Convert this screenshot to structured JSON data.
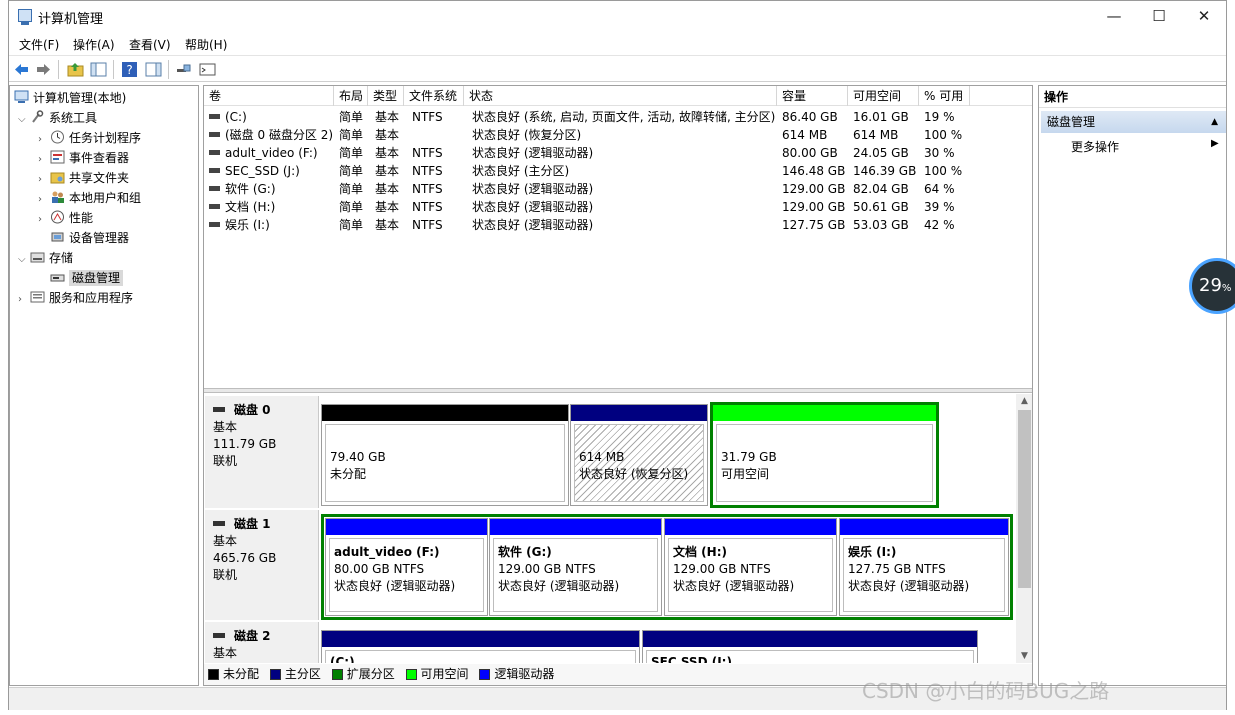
{
  "window": {
    "title": "计算机管理",
    "minimize": "—",
    "maximize": "☐",
    "close": "✕"
  },
  "menu": [
    "文件(F)",
    "操作(A)",
    "查看(V)",
    "帮助(H)"
  ],
  "tree": {
    "root": "计算机管理(本地)",
    "system_tools": "系统工具",
    "task_scheduler": "任务计划程序",
    "event_viewer": "事件查看器",
    "shared_folders": "共享文件夹",
    "local_users": "本地用户和组",
    "performance": "性能",
    "device_manager": "设备管理器",
    "storage": "存储",
    "disk_management": "磁盘管理",
    "services": "服务和应用程序"
  },
  "volumes": {
    "headers": {
      "volume": "卷",
      "layout": "布局",
      "type": "类型",
      "fs": "文件系统",
      "status": "状态",
      "capacity": "容量",
      "free": "可用空间",
      "pct": "% 可用"
    },
    "rows": [
      {
        "volume": "(C:)",
        "layout": "简单",
        "type": "基本",
        "fs": "NTFS",
        "status": "状态良好 (系统, 启动, 页面文件, 活动, 故障转储, 主分区)",
        "capacity": "86.40 GB",
        "free": "16.01 GB",
        "pct": "19 %"
      },
      {
        "volume": "(磁盘 0 磁盘分区 2)",
        "layout": "简单",
        "type": "基本",
        "fs": "",
        "status": "状态良好 (恢复分区)",
        "capacity": "614 MB",
        "free": "614 MB",
        "pct": "100 %"
      },
      {
        "volume": "adult_video (F:)",
        "layout": "简单",
        "type": "基本",
        "fs": "NTFS",
        "status": "状态良好 (逻辑驱动器)",
        "capacity": "80.00 GB",
        "free": "24.05 GB",
        "pct": "30 %"
      },
      {
        "volume": "SEC_SSD (J:)",
        "layout": "简单",
        "type": "基本",
        "fs": "NTFS",
        "status": "状态良好 (主分区)",
        "capacity": "146.48 GB",
        "free": "146.39 GB",
        "pct": "100 %"
      },
      {
        "volume": "软件 (G:)",
        "layout": "简单",
        "type": "基本",
        "fs": "NTFS",
        "status": "状态良好 (逻辑驱动器)",
        "capacity": "129.00 GB",
        "free": "82.04 GB",
        "pct": "64 %"
      },
      {
        "volume": "文档 (H:)",
        "layout": "简单",
        "type": "基本",
        "fs": "NTFS",
        "status": "状态良好 (逻辑驱动器)",
        "capacity": "129.00 GB",
        "free": "50.61 GB",
        "pct": "39 %"
      },
      {
        "volume": "娱乐 (I:)",
        "layout": "简单",
        "type": "基本",
        "fs": "NTFS",
        "status": "状态良好 (逻辑驱动器)",
        "capacity": "127.75 GB",
        "free": "53.03 GB",
        "pct": "42 %"
      }
    ]
  },
  "disks": [
    {
      "name": "磁盘 0",
      "kind": "基本",
      "size": "111.79 GB",
      "state": "联机",
      "partitions": [
        {
          "title": "",
          "line1": "79.40 GB",
          "line2": "未分配"
        },
        {
          "title": "",
          "line1": "614 MB",
          "line2": "状态良好 (恢复分区)"
        },
        {
          "title": "",
          "line1": "31.79 GB",
          "line2": "可用空间"
        }
      ]
    },
    {
      "name": "磁盘 1",
      "kind": "基本",
      "size": "465.76 GB",
      "state": "联机",
      "partitions": [
        {
          "title": "adult_video  (F:)",
          "line1": "80.00 GB NTFS",
          "line2": "状态良好 (逻辑驱动器)"
        },
        {
          "title": "软件  (G:)",
          "line1": "129.00 GB NTFS",
          "line2": "状态良好 (逻辑驱动器)"
        },
        {
          "title": "文档  (H:)",
          "line1": "129.00 GB NTFS",
          "line2": "状态良好 (逻辑驱动器)"
        },
        {
          "title": "娱乐  (I:)",
          "line1": "127.75 GB NTFS",
          "line2": "状态良好 (逻辑驱动器)"
        }
      ]
    },
    {
      "name": "磁盘 2",
      "kind": "基本",
      "partitions": [
        {
          "title": "(C:)"
        },
        {
          "title": "SEC SSD  (J:)"
        }
      ]
    }
  ],
  "legend": [
    {
      "label": "未分配",
      "color": "#000000"
    },
    {
      "label": "主分区",
      "color": "#000080"
    },
    {
      "label": "扩展分区",
      "color": "#008000"
    },
    {
      "label": "可用空间",
      "color": "#00ff00"
    },
    {
      "label": "逻辑驱动器",
      "color": "#0000ff"
    }
  ],
  "actions": {
    "header": "操作",
    "section": "磁盘管理",
    "more": "更多操作"
  },
  "overlay": {
    "badge_value": "29",
    "badge_unit": "%",
    "watermark": "CSDN @小白的码BUG之路"
  }
}
